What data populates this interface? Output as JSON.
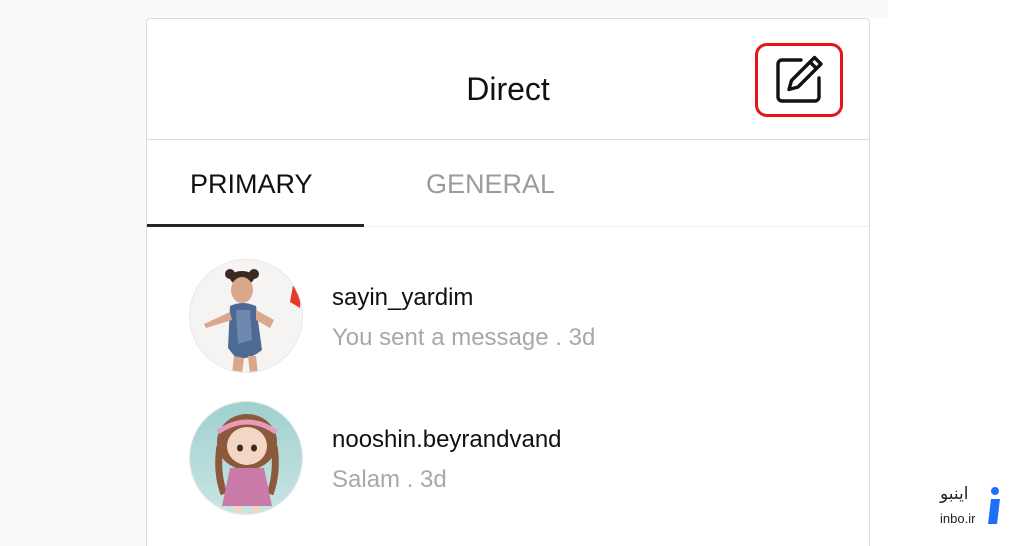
{
  "header": {
    "title": "Direct",
    "compose_icon": "compose-edit-icon"
  },
  "tabs": [
    {
      "label": "PRIMARY",
      "active": true
    },
    {
      "label": "GENERAL",
      "active": false
    }
  ],
  "threads": [
    {
      "username": "sayin_yardim",
      "preview": "You sent a message . 3d"
    },
    {
      "username": "nooshin.beyrandvand",
      "preview": "Salam . 3d"
    }
  ],
  "watermark": {
    "text_fa": "اینبو",
    "text": "inbo.ir"
  },
  "colors": {
    "highlight": "#e3141a",
    "accent_logo": "#1f6fff",
    "muted_text": "#a8a8a8"
  }
}
